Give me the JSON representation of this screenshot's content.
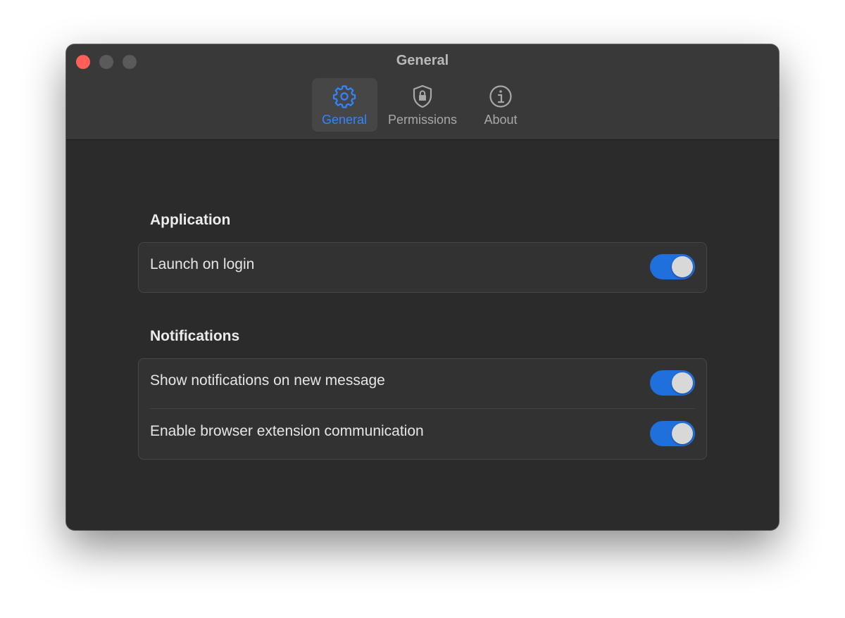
{
  "window": {
    "title": "General"
  },
  "toolbar": {
    "tabs": [
      {
        "id": "general",
        "label": "General",
        "icon": "gear-icon",
        "active": true
      },
      {
        "id": "permissions",
        "label": "Permissions",
        "icon": "shield-lock-icon",
        "active": false
      },
      {
        "id": "about",
        "label": "About",
        "icon": "info-icon",
        "active": false
      }
    ]
  },
  "sections": {
    "application": {
      "title": "Application",
      "rows": [
        {
          "label": "Launch on login",
          "enabled": true
        }
      ]
    },
    "notifications": {
      "title": "Notifications",
      "rows": [
        {
          "label": "Show notifications on new message",
          "enabled": true
        },
        {
          "label": "Enable browser extension communication",
          "enabled": true
        }
      ]
    }
  },
  "colors": {
    "accent": "#2f86ff",
    "toggle_on": "#1f70dc",
    "close": "#fe5f57"
  }
}
